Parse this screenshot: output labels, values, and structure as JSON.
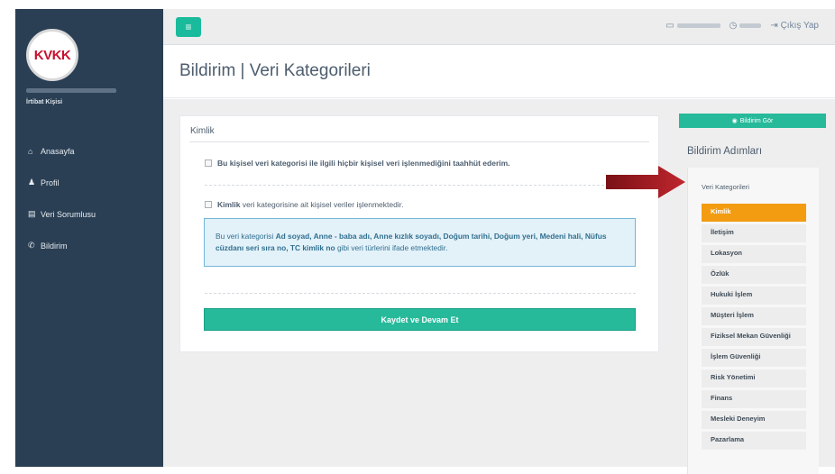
{
  "sidebar": {
    "logo_text": "KVKK",
    "user_role": "İrtibat Kişisi",
    "items": [
      {
        "icon": "home-icon",
        "glyph": "⌂",
        "label": "Anasayfa"
      },
      {
        "icon": "user-icon",
        "glyph": "♟",
        "label": "Profil"
      },
      {
        "icon": "database-icon",
        "glyph": "▤",
        "label": "Veri Sorumlusu"
      },
      {
        "icon": "bullhorn-icon",
        "glyph": "✆",
        "label": "Bildirim"
      }
    ]
  },
  "topbar": {
    "menu_glyph": "≡",
    "logout_label": "Çıkış Yap",
    "logout_glyph": "⇥"
  },
  "page": {
    "title": "Bildirim | Veri Kategorileri"
  },
  "panel": {
    "title": "Kimlik",
    "checkbox1_label": "Bu kişisel veri kategorisi ile ilgili hiçbir kişisel veri işlenmediğini taahhüt ederim.",
    "checkbox2_bold": "Kimlik",
    "checkbox2_rest": " veri kategorisine ait kişisel veriler işlenmektedir.",
    "info_prefix": "Bu veri kategorisi ",
    "info_items": "Ad soyad, Anne - baba adı, Anne kızlık soyadı, Doğum tarihi, Doğum yeri, Medeni hali, Nüfus cüzdanı seri sıra no, TC kimlik no",
    "info_suffix": " gibi veri türlerini ifade etmektedir.",
    "save_label": "Kaydet ve Devam Et"
  },
  "right": {
    "view_button": "Bildirim Gör",
    "steps_title": "Bildirim Adımları",
    "steps_label": "Veri Kategorileri",
    "steps": [
      {
        "label": "Kimlik",
        "active": true
      },
      {
        "label": "İletişim",
        "active": false
      },
      {
        "label": "Lokasyon",
        "active": false
      },
      {
        "label": "Özlük",
        "active": false
      },
      {
        "label": "Hukuki İşlem",
        "active": false
      },
      {
        "label": "Müşteri İşlem",
        "active": false
      },
      {
        "label": "Fiziksel Mekan Güvenliği",
        "active": false
      },
      {
        "label": "İşlem Güvenliği",
        "active": false
      },
      {
        "label": "Risk Yönetimi",
        "active": false
      },
      {
        "label": "Finans",
        "active": false
      },
      {
        "label": "Mesleki Deneyim",
        "active": false
      },
      {
        "label": "Pazarlama",
        "active": false
      }
    ]
  },
  "colors": {
    "sidebar": "#2a3f54",
    "accent": "#26b99a",
    "active_step": "#f39c12",
    "arrow": "#a11d24"
  }
}
